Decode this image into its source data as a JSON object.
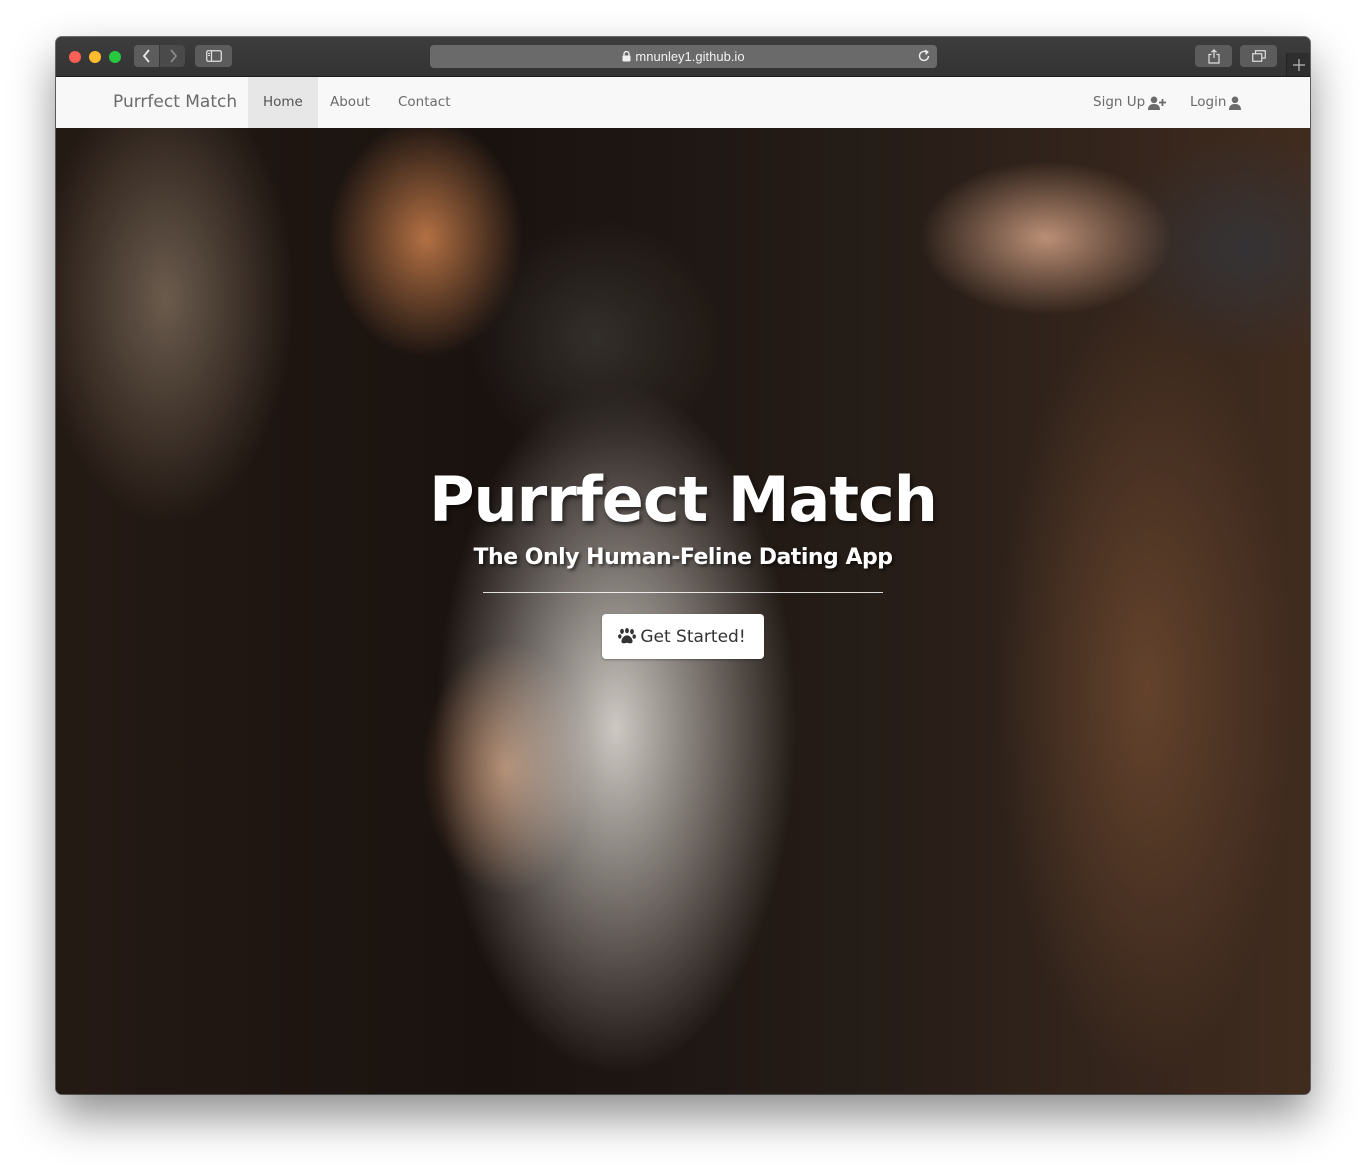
{
  "browser": {
    "url": "mnunley1.github.io"
  },
  "navbar": {
    "brand": "Purrfect Match",
    "links": [
      "Home",
      "About",
      "Contact"
    ],
    "active": "Home",
    "signup_label": "Sign Up",
    "login_label": "Login"
  },
  "hero": {
    "title": "Purrfect Match",
    "subtitle": "The Only Human-Feline Dating App",
    "cta_label": "Get Started!"
  },
  "icons": {
    "lock": "lock-icon",
    "reload": "reload-icon",
    "user_plus": "user-plus-icon",
    "user": "user-icon",
    "paw": "paw-icon"
  },
  "colors": {
    "navbar_bg": "#f8f8f8",
    "nav_active_bg": "#e7e7e7",
    "nav_text": "#6b6b6b",
    "cta_bg": "#ffffff",
    "cta_text": "#333333"
  }
}
